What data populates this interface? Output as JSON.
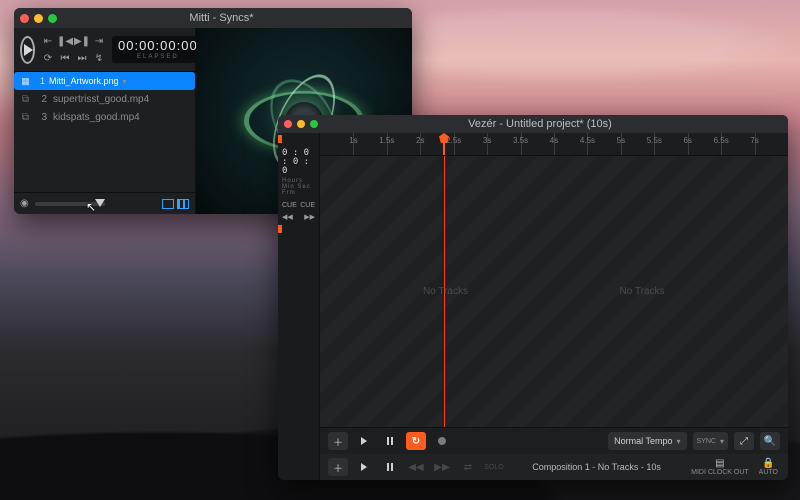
{
  "mitti": {
    "title": "Mitti - Syncs*",
    "timecode": "00:00:00:00",
    "timecode_label": "ELAPSED",
    "playlist": [
      {
        "idx": "1",
        "name": "Mitti_Artwork.png",
        "type": "image",
        "selected": true
      },
      {
        "idx": "2",
        "name": "supertrisst_good.mp4",
        "type": "video",
        "selected": false
      },
      {
        "idx": "3",
        "name": "kidspats_good.mp4",
        "type": "video",
        "selected": false
      }
    ]
  },
  "vezer": {
    "title": "Vezér - Untitled project* (10s)",
    "timecode": "0 : 0 : 0 : 0",
    "timecode_label": "Hours   Min    Sec    Frm",
    "cue_prev": "CUE",
    "cue_prev_icon": "◀◀",
    "cue_next": "CUE",
    "cue_next_icon": "▶▶",
    "ruler_ticks": [
      "1s",
      "1.5s",
      "2s",
      "2.5s",
      "3s",
      "3.5s",
      "4s",
      "4.5s",
      "5s",
      "5.5s",
      "6s",
      "6.5s",
      "7s"
    ],
    "no_tracks": "No Tracks",
    "tempo": "Normal Tempo",
    "sync": "SYNC",
    "status": "Composition 1 - No Tracks - 10s",
    "midi_label": "MIDI CLOCK OUT",
    "auto_label": "AUTO",
    "solo": "SOLO"
  }
}
